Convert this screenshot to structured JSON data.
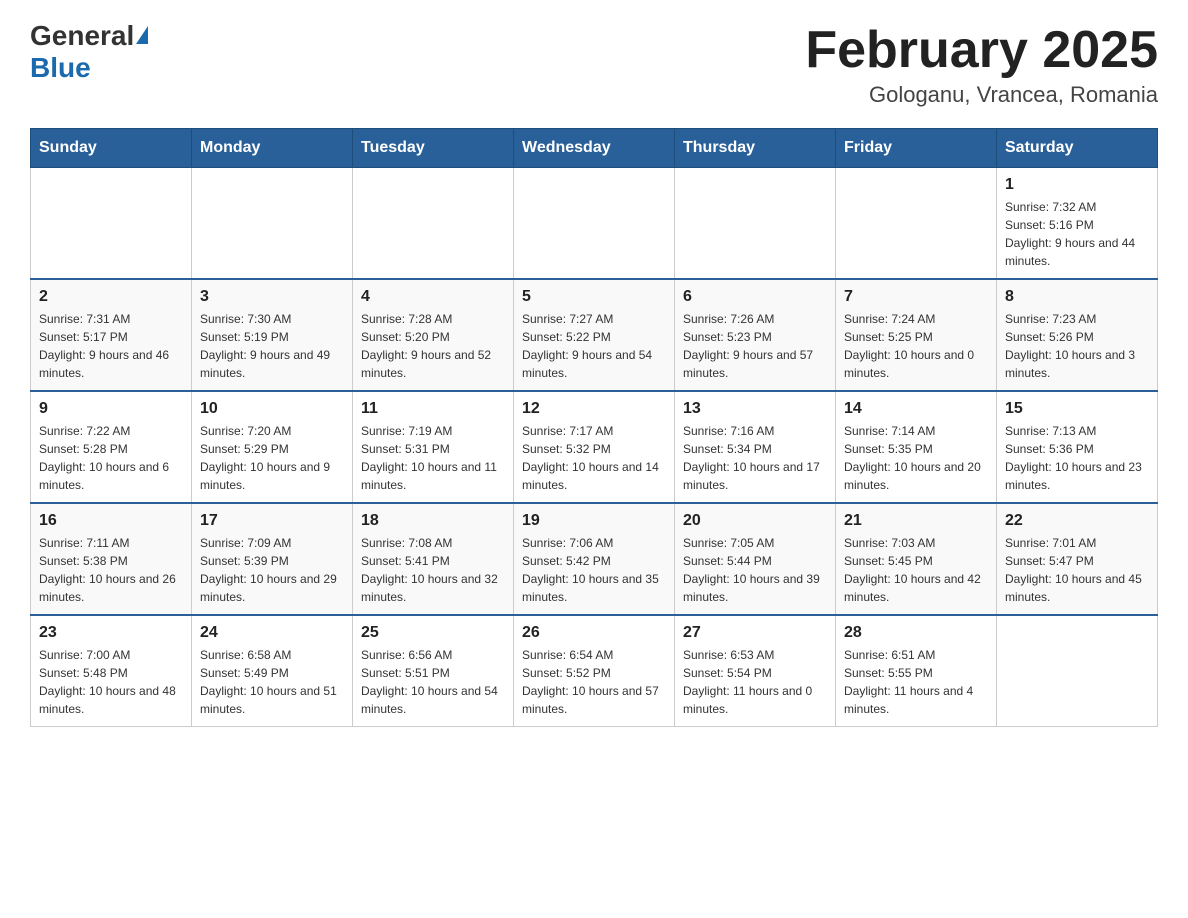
{
  "header": {
    "logo_general": "General",
    "logo_blue": "Blue",
    "title": "February 2025",
    "location": "Gologanu, Vrancea, Romania"
  },
  "days_of_week": [
    "Sunday",
    "Monday",
    "Tuesday",
    "Wednesday",
    "Thursday",
    "Friday",
    "Saturday"
  ],
  "weeks": [
    [
      {
        "day": "",
        "info": ""
      },
      {
        "day": "",
        "info": ""
      },
      {
        "day": "",
        "info": ""
      },
      {
        "day": "",
        "info": ""
      },
      {
        "day": "",
        "info": ""
      },
      {
        "day": "",
        "info": ""
      },
      {
        "day": "1",
        "info": "Sunrise: 7:32 AM\nSunset: 5:16 PM\nDaylight: 9 hours and 44 minutes."
      }
    ],
    [
      {
        "day": "2",
        "info": "Sunrise: 7:31 AM\nSunset: 5:17 PM\nDaylight: 9 hours and 46 minutes."
      },
      {
        "day": "3",
        "info": "Sunrise: 7:30 AM\nSunset: 5:19 PM\nDaylight: 9 hours and 49 minutes."
      },
      {
        "day": "4",
        "info": "Sunrise: 7:28 AM\nSunset: 5:20 PM\nDaylight: 9 hours and 52 minutes."
      },
      {
        "day": "5",
        "info": "Sunrise: 7:27 AM\nSunset: 5:22 PM\nDaylight: 9 hours and 54 minutes."
      },
      {
        "day": "6",
        "info": "Sunrise: 7:26 AM\nSunset: 5:23 PM\nDaylight: 9 hours and 57 minutes."
      },
      {
        "day": "7",
        "info": "Sunrise: 7:24 AM\nSunset: 5:25 PM\nDaylight: 10 hours and 0 minutes."
      },
      {
        "day": "8",
        "info": "Sunrise: 7:23 AM\nSunset: 5:26 PM\nDaylight: 10 hours and 3 minutes."
      }
    ],
    [
      {
        "day": "9",
        "info": "Sunrise: 7:22 AM\nSunset: 5:28 PM\nDaylight: 10 hours and 6 minutes."
      },
      {
        "day": "10",
        "info": "Sunrise: 7:20 AM\nSunset: 5:29 PM\nDaylight: 10 hours and 9 minutes."
      },
      {
        "day": "11",
        "info": "Sunrise: 7:19 AM\nSunset: 5:31 PM\nDaylight: 10 hours and 11 minutes."
      },
      {
        "day": "12",
        "info": "Sunrise: 7:17 AM\nSunset: 5:32 PM\nDaylight: 10 hours and 14 minutes."
      },
      {
        "day": "13",
        "info": "Sunrise: 7:16 AM\nSunset: 5:34 PM\nDaylight: 10 hours and 17 minutes."
      },
      {
        "day": "14",
        "info": "Sunrise: 7:14 AM\nSunset: 5:35 PM\nDaylight: 10 hours and 20 minutes."
      },
      {
        "day": "15",
        "info": "Sunrise: 7:13 AM\nSunset: 5:36 PM\nDaylight: 10 hours and 23 minutes."
      }
    ],
    [
      {
        "day": "16",
        "info": "Sunrise: 7:11 AM\nSunset: 5:38 PM\nDaylight: 10 hours and 26 minutes."
      },
      {
        "day": "17",
        "info": "Sunrise: 7:09 AM\nSunset: 5:39 PM\nDaylight: 10 hours and 29 minutes."
      },
      {
        "day": "18",
        "info": "Sunrise: 7:08 AM\nSunset: 5:41 PM\nDaylight: 10 hours and 32 minutes."
      },
      {
        "day": "19",
        "info": "Sunrise: 7:06 AM\nSunset: 5:42 PM\nDaylight: 10 hours and 35 minutes."
      },
      {
        "day": "20",
        "info": "Sunrise: 7:05 AM\nSunset: 5:44 PM\nDaylight: 10 hours and 39 minutes."
      },
      {
        "day": "21",
        "info": "Sunrise: 7:03 AM\nSunset: 5:45 PM\nDaylight: 10 hours and 42 minutes."
      },
      {
        "day": "22",
        "info": "Sunrise: 7:01 AM\nSunset: 5:47 PM\nDaylight: 10 hours and 45 minutes."
      }
    ],
    [
      {
        "day": "23",
        "info": "Sunrise: 7:00 AM\nSunset: 5:48 PM\nDaylight: 10 hours and 48 minutes."
      },
      {
        "day": "24",
        "info": "Sunrise: 6:58 AM\nSunset: 5:49 PM\nDaylight: 10 hours and 51 minutes."
      },
      {
        "day": "25",
        "info": "Sunrise: 6:56 AM\nSunset: 5:51 PM\nDaylight: 10 hours and 54 minutes."
      },
      {
        "day": "26",
        "info": "Sunrise: 6:54 AM\nSunset: 5:52 PM\nDaylight: 10 hours and 57 minutes."
      },
      {
        "day": "27",
        "info": "Sunrise: 6:53 AM\nSunset: 5:54 PM\nDaylight: 11 hours and 0 minutes."
      },
      {
        "day": "28",
        "info": "Sunrise: 6:51 AM\nSunset: 5:55 PM\nDaylight: 11 hours and 4 minutes."
      },
      {
        "day": "",
        "info": ""
      }
    ]
  ]
}
